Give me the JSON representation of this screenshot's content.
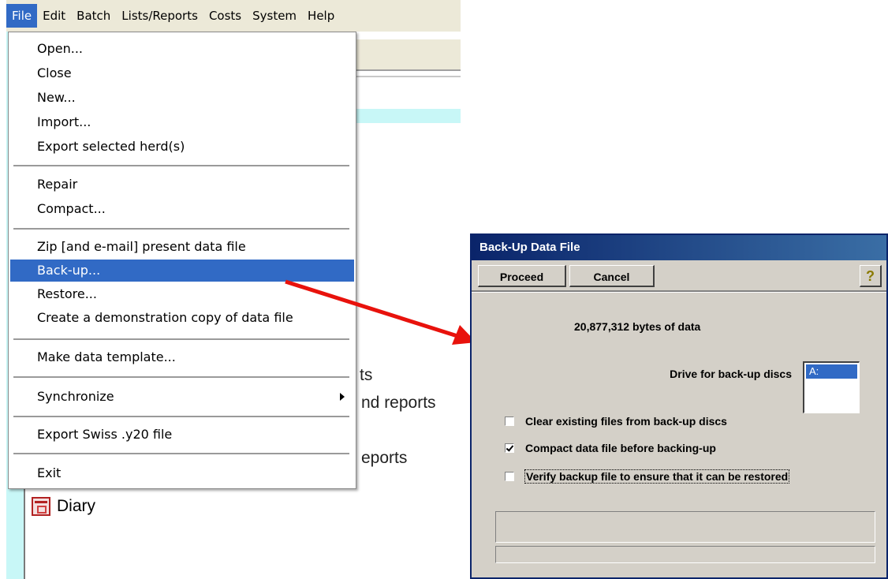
{
  "menubar": {
    "items": [
      "File",
      "Edit",
      "Batch",
      "Lists/Reports",
      "Costs",
      "System",
      "Help"
    ]
  },
  "file_menu": {
    "items": [
      {
        "label": "Open..."
      },
      {
        "label": "Close"
      },
      {
        "label": "New..."
      },
      {
        "label": "Import..."
      },
      {
        "label": "Export selected herd(s)"
      },
      {
        "label": "Repair"
      },
      {
        "label": "Compact..."
      },
      {
        "label": "Zip [and e-mail] present data file"
      },
      {
        "label": "Back-up...",
        "selected": true
      },
      {
        "label": "Restore..."
      },
      {
        "label": "Create a demonstration copy of data file"
      },
      {
        "label": "Make data template..."
      },
      {
        "label": "Synchronize",
        "has_submenu": true
      },
      {
        "label": "Export Swiss .y20 file"
      },
      {
        "label": "Exit"
      }
    ]
  },
  "background": {
    "partial_text_1": "ts",
    "partial_text_2": "nd reports",
    "partial_text_3": "eports",
    "diary_label": "Diary"
  },
  "dialog": {
    "title": "Back-Up Data File",
    "proceed_label": "Proceed",
    "cancel_label": "Cancel",
    "help_icon": "question-mark-icon",
    "bytes_info": "20,877,312  bytes of data",
    "drive_label": "Drive for back-up discs",
    "drive_options": [
      "A:"
    ],
    "checkboxes": [
      {
        "label": "Clear existing files from back-up discs",
        "checked": false
      },
      {
        "label": "Compact data file before backing-up",
        "checked": true
      },
      {
        "label": "Verify backup file to ensure that it can be restored",
        "checked": false
      }
    ]
  },
  "colors": {
    "selection": "#316ac5",
    "arrow": "#e8120c",
    "title_bar": "#0a246a"
  }
}
